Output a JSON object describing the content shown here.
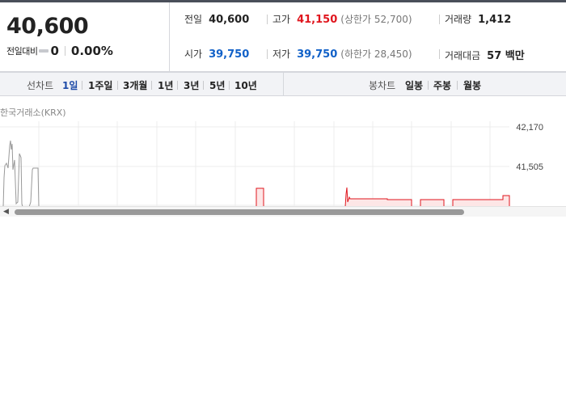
{
  "quote": {
    "price": "40,600",
    "change_label": "전일대비",
    "change_value": "0",
    "change_pct": "0.00%",
    "prev_close_label": "전일",
    "prev_close": "40,600",
    "high_label": "고가",
    "high": "41,150",
    "upper_limit": "(상한가 52,700)",
    "volume_label": "거래량",
    "volume": "1,412",
    "open_label": "시가",
    "open": "39,750",
    "low_label": "저가",
    "low": "39,750",
    "lower_limit": "(하한가 28,450)",
    "turnover_label": "거래대금",
    "turnover": "57 백만"
  },
  "tabs": {
    "line_chart_label": "선차트",
    "line_periods": [
      "1일",
      "1주일",
      "3개월",
      "1년",
      "3년",
      "5년",
      "10년"
    ],
    "active_period": "1일",
    "candle_chart_label": "봉차트",
    "candle_periods": [
      "일봉",
      "주봉",
      "월봉"
    ]
  },
  "chart": {
    "source": "한국거래소(KRX)",
    "y_ticks": [
      "42,170",
      "41,505"
    ],
    "colors": {
      "up": "#e0161e",
      "down": "#1161c8",
      "fill": "#fde6e6"
    }
  },
  "icons": {
    "scroll_left": "left-arrow-icon",
    "flat": "flat-change-icon"
  }
}
